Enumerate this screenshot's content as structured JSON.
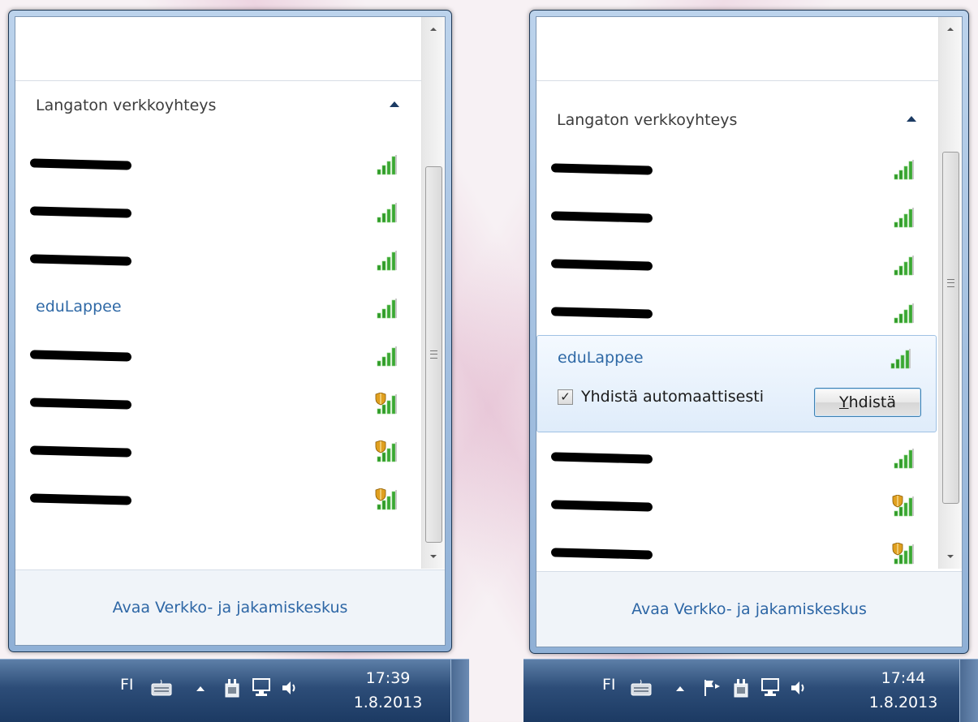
{
  "left": {
    "section_title": "Langaton verkkoyhteys",
    "networks": [
      {
        "name": "",
        "redacted": true,
        "secured": false
      },
      {
        "name": "",
        "redacted": true,
        "secured": false
      },
      {
        "name": "",
        "redacted": true,
        "secured": false
      },
      {
        "name": "eduLappee",
        "redacted": false,
        "secured": false
      },
      {
        "name": "",
        "redacted": true,
        "secured": false
      },
      {
        "name": "",
        "redacted": true,
        "secured": true
      },
      {
        "name": "",
        "redacted": true,
        "secured": true
      },
      {
        "name": "",
        "redacted": true,
        "secured": true
      }
    ],
    "footer_link": "Avaa Verkko- ja jakamiskeskus",
    "taskbar": {
      "language": "FI",
      "time": "17:39",
      "date": "1.8.2013"
    }
  },
  "right": {
    "section_title": "Langaton verkkoyhteys",
    "networks_before": [
      {
        "name": "",
        "redacted": true,
        "secured": false
      },
      {
        "name": "",
        "redacted": true,
        "secured": false
      },
      {
        "name": "",
        "redacted": true,
        "secured": false
      },
      {
        "name": "",
        "redacted": true,
        "secured": false
      }
    ],
    "selected": {
      "name": "eduLappee",
      "auto_connect_label": "Yhdistä automaattisesti",
      "auto_connect_checked": true,
      "connect_prefix": "Y",
      "connect_rest": "hdistä"
    },
    "networks_after": [
      {
        "name": "",
        "redacted": true,
        "secured": false
      },
      {
        "name": "",
        "redacted": true,
        "secured": true
      },
      {
        "name": "",
        "redacted": true,
        "secured": true
      }
    ],
    "footer_link": "Avaa Verkko- ja jakamiskeskus",
    "taskbar": {
      "language": "FI",
      "time": "17:44",
      "date": "1.8.2013"
    }
  },
  "colors": {
    "link": "#2f69a6",
    "signal_green": "#2e9a27",
    "shield": "#e0a020"
  },
  "icons": [
    "signal-icon",
    "shield-icon",
    "keyboard-icon",
    "flag-icon",
    "power-icon",
    "network-icon",
    "volume-icon",
    "chevron-up-icon"
  ]
}
